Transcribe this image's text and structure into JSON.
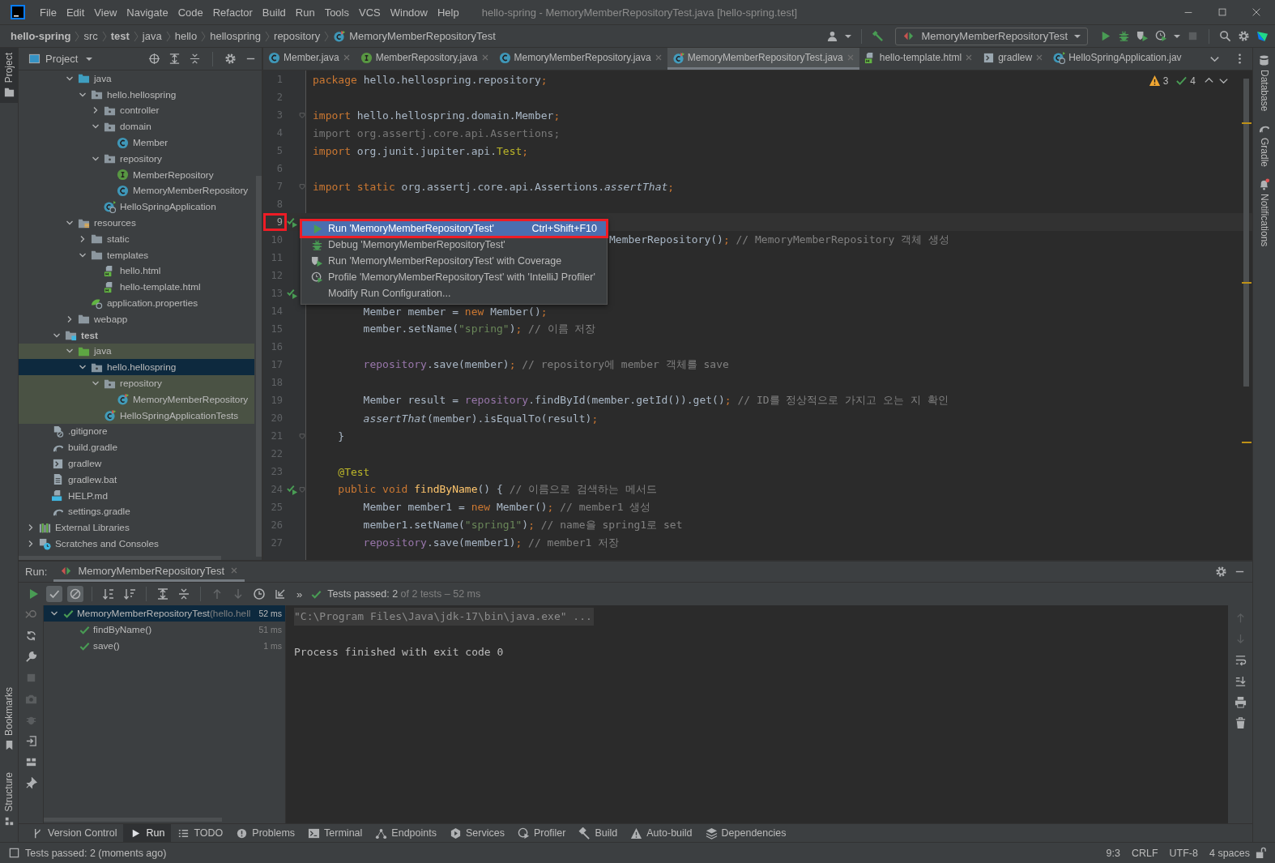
{
  "window": {
    "title": "hello-spring - MemoryMemberRepositoryTest.java [hello-spring.test]"
  },
  "menu": [
    "File",
    "Edit",
    "View",
    "Navigate",
    "Code",
    "Refactor",
    "Build",
    "Run",
    "Tools",
    "VCS",
    "Window",
    "Help"
  ],
  "breadcrumbs": [
    {
      "label": "hello-spring",
      "kind": "module"
    },
    {
      "label": "src",
      "kind": "folder"
    },
    {
      "label": "test",
      "kind": "module"
    },
    {
      "label": "java",
      "kind": "folder"
    },
    {
      "label": "hello",
      "kind": "folder"
    },
    {
      "label": "hellospring",
      "kind": "folder"
    },
    {
      "label": "repository",
      "kind": "folder"
    },
    {
      "label": "MemoryMemberRepositoryTest",
      "kind": "test"
    }
  ],
  "run_config": {
    "label": "MemoryMemberRepositoryTest"
  },
  "left_stripe": {
    "top": [
      {
        "label": "Project",
        "selected": true
      }
    ],
    "bottom": [
      {
        "label": "Bookmarks",
        "selected": false
      },
      {
        "label": "Structure",
        "selected": false
      }
    ]
  },
  "right_stripe": [
    {
      "label": "Database",
      "kind": "database"
    },
    {
      "label": "Gradle",
      "kind": "gradle"
    },
    {
      "label": "Notifications",
      "kind": "bell"
    }
  ],
  "project": {
    "title": "Project",
    "tree": [
      {
        "children": [
          {
            "children": [
              {
                "children": [
                  {
                    "label": "java",
                    "kind": "src",
                    "expanded": true,
                    "selected": false,
                    "highlighted": false,
                    "children": [
                      {
                        "label": "hello.hellospring",
                        "kind": "package",
                        "expanded": true,
                        "selected": false,
                        "highlighted": false,
                        "children": [
                          {
                            "label": "controller",
                            "kind": "package",
                            "expanded": false,
                            "selected": false,
                            "highlighted": false
                          },
                          {
                            "label": "domain",
                            "kind": "package",
                            "expanded": true,
                            "selected": false,
                            "highlighted": false,
                            "children": [
                              {
                                "label": "Member",
                                "kind": "class",
                                "selected": false,
                                "highlighted": false
                              }
                            ]
                          },
                          {
                            "label": "repository",
                            "kind": "package",
                            "expanded": true,
                            "selected": false,
                            "highlighted": false,
                            "children": [
                              {
                                "label": "MemberRepository",
                                "kind": "interface",
                                "selected": false,
                                "highlighted": false
                              },
                              {
                                "label": "MemoryMemberRepository",
                                "kind": "class",
                                "selected": false,
                                "highlighted": false
                              }
                            ]
                          },
                          {
                            "label": "HelloSpringApplication",
                            "kind": "spring",
                            "selected": false,
                            "highlighted": false
                          }
                        ]
                      }
                    ]
                  },
                  {
                    "label": "resources",
                    "kind": "resources",
                    "expanded": true,
                    "selected": false,
                    "highlighted": false,
                    "children": [
                      {
                        "label": "static",
                        "kind": "folder",
                        "expanded": false,
                        "selected": false,
                        "highlighted": false
                      },
                      {
                        "label": "templates",
                        "kind": "folder",
                        "expanded": true,
                        "selected": false,
                        "highlighted": false,
                        "children": [
                          {
                            "label": "hello.html",
                            "kind": "html",
                            "selected": false,
                            "highlighted": false
                          },
                          {
                            "label": "hello-template.html",
                            "kind": "html",
                            "selected": false,
                            "highlighted": false
                          }
                        ]
                      },
                      {
                        "label": "application.properties",
                        "kind": "properties",
                        "selected": false,
                        "highlighted": false
                      }
                    ]
                  },
                  {
                    "label": "webapp",
                    "kind": "folder",
                    "expanded": false,
                    "selected": false,
                    "highlighted": false
                  }
                ]
              },
              {
                "label": "test",
                "kind": "test-root",
                "expanded": true,
                "selected": false,
                "highlighted": false,
                "children": [
                  {
                    "label": "java",
                    "kind": "test-src",
                    "expanded": true,
                    "selected": false,
                    "highlighted": true,
                    "children": [
                      {
                        "label": "hello.hellospring",
                        "kind": "package",
                        "expanded": true,
                        "selected": true,
                        "children": [
                          {
                            "label": "repository",
                            "kind": "package",
                            "expanded": true,
                            "selected": false,
                            "highlighted": true,
                            "children": [
                              {
                                "label": "MemoryMemberRepository",
                                "kind": "test-class",
                                "selected": false,
                                "highlighted": true
                              }
                            ]
                          },
                          {
                            "label": "HelloSpringApplicationTests",
                            "kind": "test-class",
                            "selected": false,
                            "highlighted": true
                          }
                        ]
                      }
                    ]
                  }
                ]
              }
            ]
          },
          {
            "label": ".gitignore",
            "kind": "ignore",
            "selected": false,
            "highlighted": false
          },
          {
            "label": "build.gradle",
            "kind": "gradle",
            "selected": false,
            "highlighted": false
          },
          {
            "label": "gradlew",
            "kind": "script",
            "selected": false,
            "highlighted": false
          },
          {
            "label": "gradlew.bat",
            "kind": "text",
            "selected": false,
            "highlighted": false
          },
          {
            "label": "HELP.md",
            "kind": "md",
            "selected": false,
            "highlighted": false
          },
          {
            "label": "settings.gradle",
            "kind": "gradle",
            "selected": false,
            "highlighted": false
          }
        ]
      },
      {
        "label": "External Libraries",
        "kind": "libraries",
        "expanded": false,
        "selected": false,
        "highlighted": false
      },
      {
        "label": "Scratches and Consoles",
        "kind": "scratches",
        "expanded": false,
        "selected": false,
        "highlighted": false
      }
    ]
  },
  "editor": {
    "tabs": [
      {
        "label": "Member.java",
        "kind": "class",
        "selected": false,
        "closable": true
      },
      {
        "label": "MemberRepository.java",
        "kind": "interface",
        "selected": false,
        "closable": true
      },
      {
        "label": "MemoryMemberRepository.java",
        "kind": "class",
        "selected": false,
        "closable": true
      },
      {
        "label": "MemoryMemberRepositoryTest.java",
        "kind": "test-class",
        "selected": true,
        "closable": true
      },
      {
        "label": "hello-template.html",
        "kind": "html",
        "selected": false,
        "closable": true
      },
      {
        "label": "gradlew",
        "kind": "script",
        "selected": false,
        "closable": true
      },
      {
        "label": "HelloSpringApplication.jav",
        "kind": "spring",
        "selected": false,
        "closable": false
      }
    ],
    "inspections": {
      "warnings": "3",
      "weak_warnings": "4"
    },
    "lines": [
      {
        "number": "1",
        "tokens": [
          {
            "text": "package ",
            "kind": "kw"
          },
          {
            "text": "hello.hellospring.repository",
            "kind": "plain"
          },
          {
            "text": ";",
            "kind": "kw"
          }
        ]
      },
      {
        "number": "2"
      },
      {
        "number": "3",
        "fold": true,
        "tokens": [
          {
            "text": "import ",
            "kind": "kw"
          },
          {
            "text": "hello.hellospring.domain.Member",
            "kind": "plain"
          },
          {
            "text": ";",
            "kind": "kw"
          }
        ]
      },
      {
        "number": "4",
        "tokens": [
          {
            "text": "import org.assertj.core.api.Assertions;",
            "kind": "dim"
          }
        ]
      },
      {
        "number": "5",
        "tokens": [
          {
            "text": "import ",
            "kind": "kw"
          },
          {
            "text": "org.junit.jupiter.api.",
            "kind": "plain"
          },
          {
            "text": "Test",
            "kind": "ann"
          },
          {
            "text": ";",
            "kind": "kw"
          }
        ]
      },
      {
        "number": "6"
      },
      {
        "number": "7",
        "fold": true,
        "tokens": [
          {
            "text": "import static ",
            "kind": "kw"
          },
          {
            "text": "org.assertj.core.api.Assertions.",
            "kind": "plain"
          },
          {
            "text": "assertThat",
            "kind": "italic"
          },
          {
            "text": ";",
            "kind": "kw"
          }
        ]
      },
      {
        "number": "8"
      },
      {
        "number": "9",
        "runnable": true,
        "current": true,
        "annotated": true
      },
      {
        "number": "10",
        "kind": "partial",
        "tokens": [
          {
            "text": "MemberRepository()",
            "kind": "plain"
          },
          {
            "text": ";",
            "kind": "kw"
          },
          {
            "text": " // MemoryMemberRepository 객체 생성",
            "kind": "comment"
          }
        ]
      },
      {
        "number": "11"
      },
      {
        "number": "12"
      },
      {
        "number": "13",
        "runnable": true
      },
      {
        "number": "14",
        "tokens": [
          {
            "text": "        Member member = ",
            "kind": "plain"
          },
          {
            "text": "new ",
            "kind": "kw"
          },
          {
            "text": "Member()",
            "kind": "plain"
          },
          {
            "text": ";",
            "kind": "kw"
          }
        ]
      },
      {
        "number": "15",
        "tokens": [
          {
            "text": "        member.setName(",
            "kind": "plain"
          },
          {
            "text": "\"spring\"",
            "kind": "str"
          },
          {
            "text": ")",
            "kind": "plain"
          },
          {
            "text": ";",
            "kind": "kw"
          },
          {
            "text": " // 이름 저장",
            "kind": "comment"
          }
        ]
      },
      {
        "number": "16"
      },
      {
        "number": "17",
        "tokens": [
          {
            "text": "        repository",
            "kind": "field"
          },
          {
            "text": ".save(member)",
            "kind": "plain"
          },
          {
            "text": ";",
            "kind": "kw"
          },
          {
            "text": " // repository에 member 객체를 save",
            "kind": "comment"
          }
        ]
      },
      {
        "number": "18"
      },
      {
        "number": "19",
        "tokens": [
          {
            "text": "        Member result = ",
            "kind": "plain"
          },
          {
            "text": "repository",
            "kind": "field"
          },
          {
            "text": ".findById(member.getId()).get()",
            "kind": "plain"
          },
          {
            "text": ";",
            "kind": "kw"
          },
          {
            "text": " // ID를 정상적으로 가지고 오는 지 확인",
            "kind": "comment"
          }
        ]
      },
      {
        "number": "20",
        "tokens": [
          {
            "text": "        assertThat",
            "kind": "italic"
          },
          {
            "text": "(member).isEqualTo(result)",
            "kind": "plain"
          },
          {
            "text": ";",
            "kind": "kw"
          }
        ]
      },
      {
        "number": "21",
        "fold": true,
        "tokens": [
          {
            "text": "    }",
            "kind": "plain"
          }
        ]
      },
      {
        "number": "22"
      },
      {
        "number": "23",
        "tokens": [
          {
            "text": "    @Test",
            "kind": "ann"
          }
        ]
      },
      {
        "number": "24",
        "runnable": true,
        "fold": true,
        "tokens": [
          {
            "text": "    public void ",
            "kind": "kw"
          },
          {
            "text": "findByName",
            "kind": "fn"
          },
          {
            "text": "() { ",
            "kind": "plain"
          },
          {
            "text": "// 이름으로 검색하는 메서드",
            "kind": "comment"
          }
        ]
      },
      {
        "number": "25",
        "tokens": [
          {
            "text": "        Member member1 = ",
            "kind": "plain"
          },
          {
            "text": "new ",
            "kind": "kw"
          },
          {
            "text": "Member()",
            "kind": "plain"
          },
          {
            "text": ";",
            "kind": "kw"
          },
          {
            "text": " // member1 생성",
            "kind": "comment"
          }
        ]
      },
      {
        "number": "26",
        "tokens": [
          {
            "text": "        member1.setName(",
            "kind": "plain"
          },
          {
            "text": "\"spring1\"",
            "kind": "str"
          },
          {
            "text": ")",
            "kind": "plain"
          },
          {
            "text": ";",
            "kind": "kw"
          },
          {
            "text": " // name을 spring1로 set",
            "kind": "comment"
          }
        ]
      },
      {
        "number": "27",
        "tokens": [
          {
            "text": "        repository",
            "kind": "field"
          },
          {
            "text": ".save(member1)",
            "kind": "plain"
          },
          {
            "text": ";",
            "kind": "kw"
          },
          {
            "text": " // member1 저장",
            "kind": "comment"
          }
        ]
      }
    ],
    "popup": {
      "items": [
        {
          "label": "Run 'MemoryMemberRepositoryTest'",
          "shortcut": "Ctrl+Shift+F10",
          "kind": "run",
          "selected": true,
          "annotated": true
        },
        {
          "label": "Debug 'MemoryMemberRepositoryTest'",
          "kind": "debug",
          "selected": false,
          "annotated": false
        },
        {
          "label": "Run 'MemoryMemberRepositoryTest' with Coverage",
          "kind": "coverage",
          "selected": false,
          "annotated": false
        },
        {
          "label": "Profile 'MemoryMemberRepositoryTest' with 'IntelliJ Profiler'",
          "kind": "profile",
          "selected": false,
          "annotated": false
        },
        {
          "label": "Modify Run Configuration...",
          "kind": "configure",
          "selected": false,
          "annotated": false
        }
      ]
    }
  },
  "run": {
    "label": "Run:",
    "tab": "MemoryMemberRepositoryTest",
    "toolbar": [
      {
        "kind": "run"
      },
      {
        "kind": "passed",
        "on": true
      },
      {
        "kind": "ignored",
        "on": true
      },
      {
        "kind": "sort-alpha"
      },
      {
        "kind": "sort-duration"
      },
      {
        "kind": "expand"
      },
      {
        "kind": "collapse"
      },
      {
        "kind": "up",
        "disabled": true
      },
      {
        "kind": "down",
        "disabled": true
      },
      {
        "kind": "history"
      },
      {
        "kind": "import"
      }
    ],
    "more": "»",
    "summary": "Tests passed: 2",
    "summary_detail": " of 2 tests – 52 ms",
    "tests": [
      {
        "name": "MemoryMemberRepositoryTest",
        "detail": "(hello.hell",
        "time": "52 ms",
        "passed": true,
        "expanded": true,
        "selected": true,
        "children": [
          {
            "name": "findByName()",
            "time": "51 ms",
            "passed": true,
            "selected": false
          },
          {
            "name": "save()",
            "time": "1 ms",
            "passed": true,
            "selected": false
          }
        ]
      }
    ],
    "console": [
      {
        "text": "\"C:\\Program Files\\Java\\jdk-17\\bin\\java.exe\" ...",
        "kind": "command"
      },
      {
        "text": "Process finished with exit code 0",
        "kind": "output"
      }
    ]
  },
  "tool_tabs": [
    {
      "label": "Version Control",
      "kind": "vcs",
      "selected": false
    },
    {
      "label": "Run",
      "kind": "run",
      "selected": true
    },
    {
      "label": "TODO",
      "kind": "list",
      "selected": false
    },
    {
      "label": "Problems",
      "kind": "problems",
      "selected": false
    },
    {
      "label": "Terminal",
      "kind": "terminal",
      "selected": false
    },
    {
      "label": "Endpoints",
      "kind": "endpoints",
      "selected": false
    },
    {
      "label": "Services",
      "kind": "services",
      "selected": false
    },
    {
      "label": "Profiler",
      "kind": "profiler",
      "selected": false
    },
    {
      "label": "Build",
      "kind": "hammer",
      "selected": false
    },
    {
      "label": "Auto-build",
      "kind": "warning",
      "selected": false
    },
    {
      "label": "Dependencies",
      "kind": "layers",
      "selected": false
    }
  ],
  "status": {
    "message": "Tests passed: 2 (moments ago)",
    "position": "9:3",
    "line_separator": "CRLF",
    "encoding": "UTF-8",
    "indent": "4 spaces"
  }
}
